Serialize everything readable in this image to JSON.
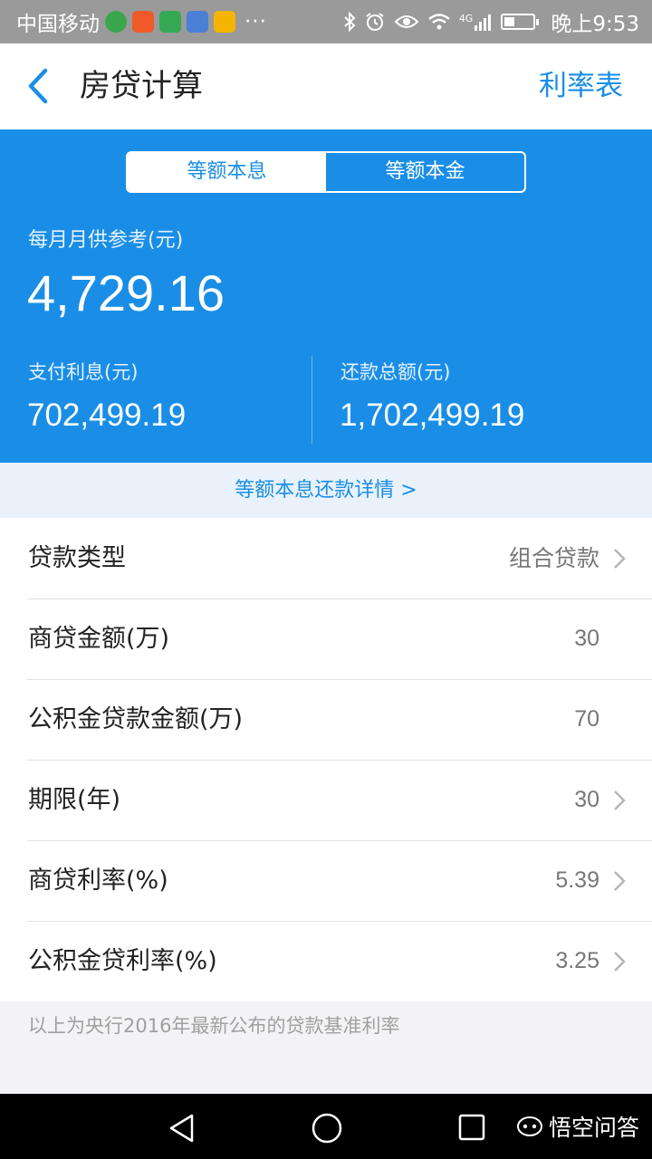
{
  "status_bar": {
    "carrier": "中国移动",
    "dots": "···",
    "network": "4G",
    "time": "晚上9:53",
    "battery_level": 0.35,
    "app_icon_colors": [
      "#3aa64b",
      "#f05a28",
      "#35a853",
      "#4a7fd6",
      "#f5b400"
    ]
  },
  "header": {
    "title": "房贷计算",
    "rate_table_label": "利率表"
  },
  "summary": {
    "tabs": [
      {
        "label": "等额本息",
        "active": true
      },
      {
        "label": "等额本金",
        "active": false
      }
    ],
    "monthly_label": "每月月供参考(元)",
    "monthly_value": "4,729.16",
    "interest_label": "支付利息(元)",
    "interest_value": "702,499.19",
    "total_label": "还款总额(元)",
    "total_value": "1,702,499.19"
  },
  "detail_link": "等额本息还款详情 >",
  "rows": [
    {
      "label": "贷款类型",
      "value": "组合贷款",
      "has_chevron": true
    },
    {
      "label": "商贷金额(万)",
      "value": "30",
      "has_chevron": false
    },
    {
      "label": "公积金贷款金额(万)",
      "value": "70",
      "has_chevron": false
    },
    {
      "label": "期限(年)",
      "value": "30",
      "has_chevron": true
    },
    {
      "label": "商贷利率(%)",
      "value": "5.39",
      "has_chevron": true
    },
    {
      "label": "公积金贷利率(%)",
      "value": "3.25",
      "has_chevron": true
    }
  ],
  "note": "以上为央行2016年最新公布的贷款基准利率",
  "watermark": "悟空问答",
  "colors": {
    "accent": "#1a8ee6",
    "status_bar": "#9a9a9a",
    "nav_bar": "#000000"
  }
}
